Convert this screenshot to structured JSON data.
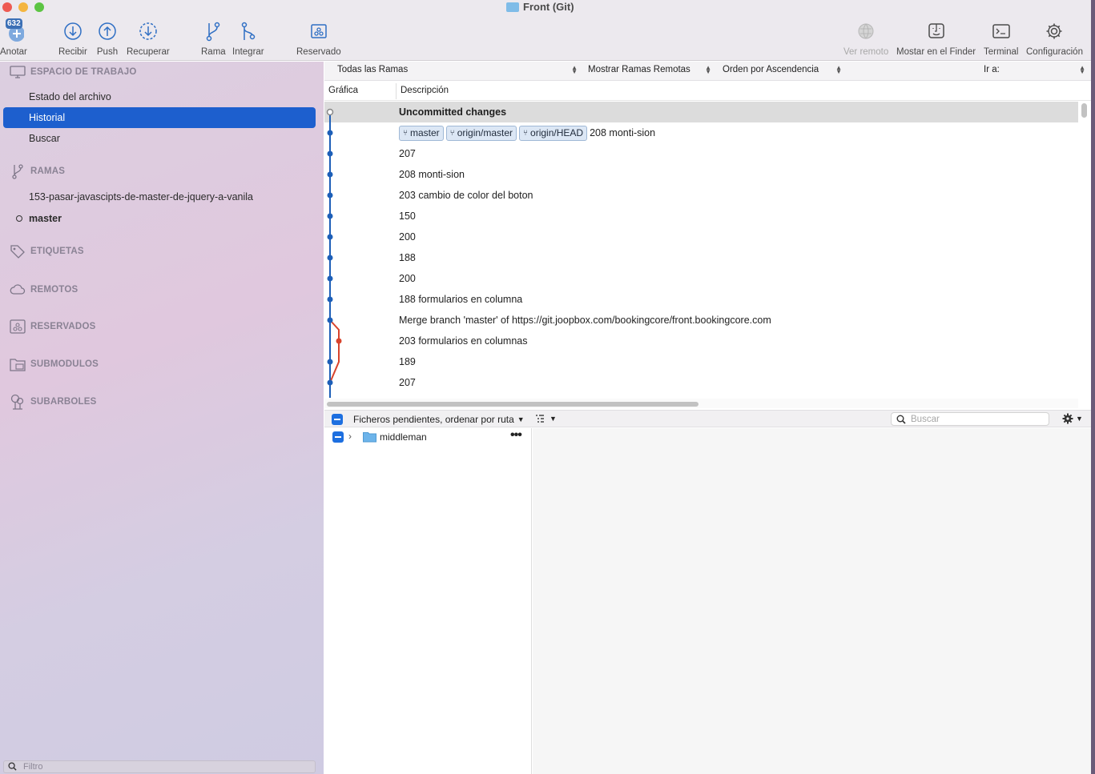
{
  "window": {
    "title": "Front (Git)"
  },
  "toolbar": {
    "commit": {
      "label": "Anotar",
      "badge": "632"
    },
    "pull": {
      "label": "Recibir"
    },
    "push": {
      "label": "Push"
    },
    "fetch": {
      "label": "Recuperar"
    },
    "branch": {
      "label": "Rama"
    },
    "merge": {
      "label": "Integrar"
    },
    "stash": {
      "label": "Reservado"
    },
    "remote": {
      "label": "Ver remoto"
    },
    "finder": {
      "label": "Mostar en el Finder"
    },
    "terminal": {
      "label": "Terminal"
    },
    "settings": {
      "label": "Configuración"
    }
  },
  "sidebar": {
    "workspace": {
      "label": "ESPACIO DE TRABAJO",
      "items": [
        {
          "label": "Estado del archivo"
        },
        {
          "label": "Historial"
        },
        {
          "label": "Buscar"
        }
      ]
    },
    "branches": {
      "label": "RAMAS",
      "items": [
        {
          "label": "153-pasar-javascipts-de-master-de-jquery-a-vanila"
        },
        {
          "label": "master"
        }
      ]
    },
    "tags": {
      "label": "ETIQUETAS"
    },
    "remotes": {
      "label": "REMOTOS"
    },
    "stashes": {
      "label": "RESERVADOS"
    },
    "submodules": {
      "label": "SUBMODULOS"
    },
    "subtrees": {
      "label": "SUBARBOLES"
    },
    "filter": {
      "placeholder": "Filtro"
    }
  },
  "history": {
    "filters": {
      "branches": "Todas las Ramas",
      "remote": "Mostrar Ramas Remotas",
      "order": "Orden por Ascendencia",
      "goto": "Ir a:"
    },
    "columns": {
      "graph": "Gráfica",
      "description": "Descripción"
    },
    "rows": [
      {
        "text": "Uncommitted changes"
      },
      {
        "tags": [
          "master",
          "origin/master",
          "origin/HEAD"
        ],
        "text": "208 monti-sion"
      },
      {
        "text": "207"
      },
      {
        "text": "208 monti-sion"
      },
      {
        "text": "203 cambio de color del boton"
      },
      {
        "text": "150"
      },
      {
        "text": "200"
      },
      {
        "text": "188"
      },
      {
        "text": "200"
      },
      {
        "text": "188 formularios en columna"
      },
      {
        "text": "Merge branch 'master' of https://git.joopbox.com/bookingcore/front.bookingcore.com"
      },
      {
        "text": "203 formularios en columnas"
      },
      {
        "text": "189"
      },
      {
        "text": "207"
      }
    ]
  },
  "files": {
    "mode": "Ficheros pendientes, ordenar por ruta",
    "search_placeholder": "Buscar",
    "tree": [
      {
        "name": "middleman"
      }
    ]
  },
  "colors": {
    "accent": "#1d5fce",
    "graph_main": "#1d5fb8",
    "graph_branch": "#d8432c"
  }
}
